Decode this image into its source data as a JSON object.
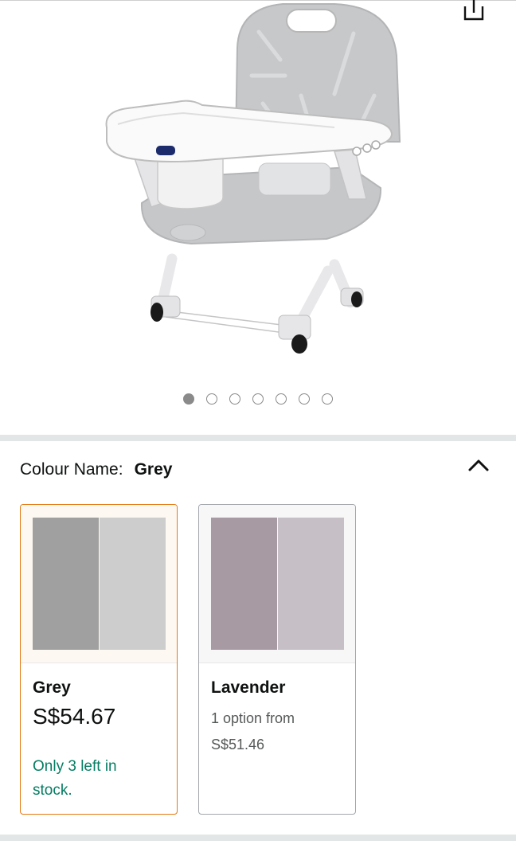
{
  "colour": {
    "label": "Colour Name:",
    "value": "Grey"
  },
  "gallery": {
    "dot_count": 7,
    "active_index": 0
  },
  "options": [
    {
      "name": "Grey",
      "price": "S$54.67",
      "stock": "Only 3 left in stock.",
      "swatch_left": "#a0a0a0",
      "swatch_right": "#cdcdcd"
    },
    {
      "name": "Lavender",
      "sub1": "1 option from",
      "sub2": "S$51.46",
      "swatch_left": "#a89aa3",
      "swatch_right": "#c6bfc6"
    }
  ],
  "colors": {
    "accent": "#e47911",
    "stock": "#067d62"
  },
  "icons": [
    "share-icon",
    "chevron-up-icon"
  ]
}
